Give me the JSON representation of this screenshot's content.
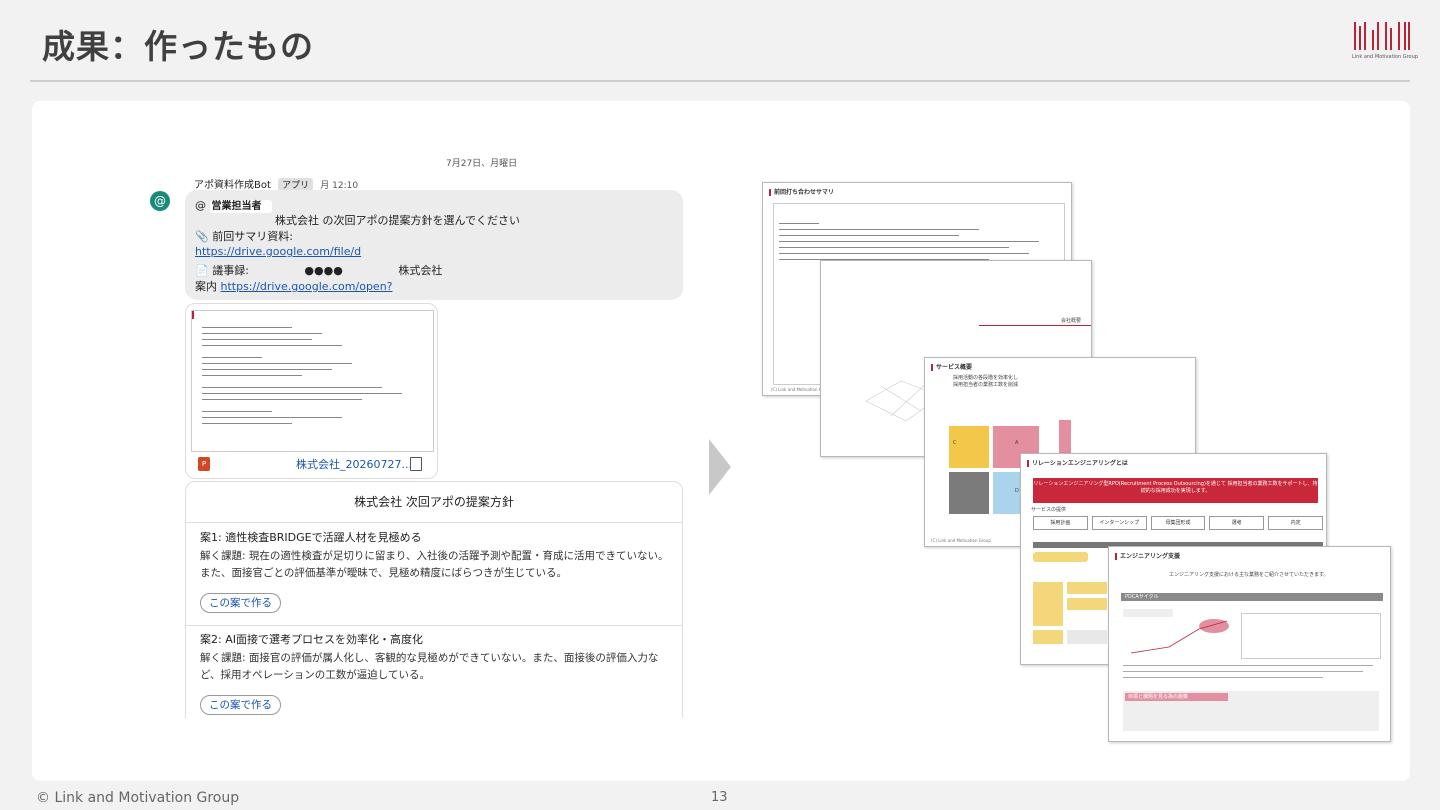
{
  "slide": {
    "title": "成果：作ったもの",
    "logo_caption": "Link and Motivation Group",
    "footer": "© Link and Motivation Group",
    "page_number": "13"
  },
  "chat": {
    "date": "7月27日、月曜日",
    "sender": "アポ資料作成Bot",
    "app_badge": "アプリ",
    "time": "月 12:10",
    "mention": "営業担当者",
    "request": "株式会社 の次回アポの提案方針を選んでください",
    "summary_label": "前回サマリ資料:",
    "summary_link": "https://drive.google.com/file/d",
    "minutes_label": "議事録:",
    "minutes_company": "株式会社",
    "minutes_masked": "●●●●",
    "guide_label": "案内",
    "guide_link": "https://drive.google.com/open?",
    "attachment_name": "株式会社_20260727...",
    "result_title": "株式会社 次回アポの提案方針",
    "plans": [
      {
        "heading": "案1: 適性検査BRIDGEで活躍人材を見極める",
        "body": "解く課題: 現在の適性検査が足切りに留まり、入社後の活躍予測や配置・育成に活用できていない。また、面接官ごとの評価基準が曖昧で、見極め精度にばらつきが生じている。",
        "button": "この案で作る"
      },
      {
        "heading": "案2: AI面接で選考プロセスを効率化・高度化",
        "body": "解く課題: 面接官の評価が属人化し、客観的な見極めができていない。また、面接後の評価入力など、採用オペレーションの工数が逼迫している。",
        "button": "この案で作る"
      }
    ]
  },
  "slides": {
    "s1_title": "前回打ち合わせサマリ",
    "s2_label": "会社概要",
    "s3_title": "サービス概要",
    "s3_sub1": "採用活動の各段階を効率化し",
    "s3_sub2": "採用担当者の業務工数を削減",
    "s3_quadrant_a": "A",
    "s3_quadrant_c": "C",
    "s3_quadrant_d": "D",
    "s4_title": "リレーションエンジニアリングとは",
    "s4_banner": "リレーションエンジニアリング型RPO(Recruitment Process Outsourcing)を通じて 採用担当者の業務工数をサポートし、持続的な採用成功を実現します。",
    "s4_steps": [
      "採用計画",
      "インターンシップ",
      "母集団形成",
      "選考",
      "内定"
    ],
    "s4_section": "サービスの提供",
    "s5_title": "エンジニアリング支援",
    "s5_sub": "エンジニアリング支援における主な業務をご紹介させていただきます。",
    "s5_bar": "PDCAサイクル",
    "s5_bar2": "目標と課題を見る為の施策",
    "footer_text": "(C) Link and Motivation Group"
  },
  "colors": {
    "accent_red": "#b8243a",
    "link_blue": "#1a56b0",
    "avatar_teal": "#1a8a7a"
  }
}
